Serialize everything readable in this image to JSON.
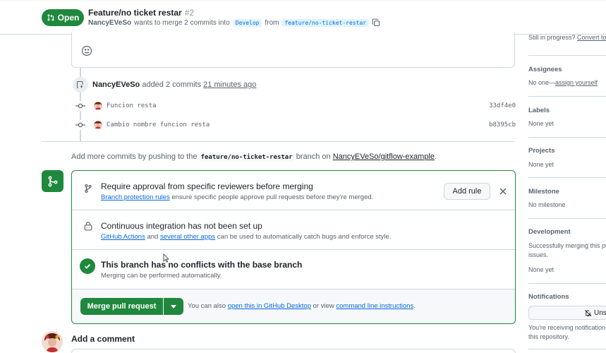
{
  "header": {
    "state": "Open",
    "title": "Feature/no ticket restar",
    "number": "#2",
    "author": "NancyEVeSo",
    "merge_text": "wants to merge 2 commits into",
    "base_branch": "Develop",
    "from_text": "from",
    "head_branch": "feature/no-ticket-restar"
  },
  "timeline": {
    "event_actor": "NancyEVeSo",
    "event_action": "added 2 commits",
    "event_time": "21 minutes ago",
    "commits": [
      {
        "message": "Funcion resta",
        "sha": "33df4e0"
      },
      {
        "message": "Cambio nombre funcion resta",
        "sha": "b8395cb"
      }
    ],
    "hint_prefix": "Add more commits by pushing to the",
    "hint_branch": "feature/no-ticket-restar",
    "hint_middle": "branch on",
    "hint_repo": "NancyEVeSo/gitflow-example",
    "hint_suffix": "."
  },
  "merge_box": {
    "review_title": "Require approval from specific reviewers before merging",
    "review_link": "Branch protection rules",
    "review_desc": "ensure specific people approve pull requests before they're merged.",
    "add_rule": "Add rule",
    "ci_title": "Continuous integration has not been set up",
    "ci_link1": "GitHub Actions",
    "ci_and": "and",
    "ci_link2": "several other apps",
    "ci_desc": "can be used to automatically catch bugs and enforce style.",
    "conflict_title": "This branch has no conflicts with the base branch",
    "conflict_desc": "Merging can be performed automatically.",
    "merge_button": "Merge pull request",
    "footer_prefix": "You can also",
    "footer_link1": "open this in GitHub Desktop",
    "footer_middle": "or view",
    "footer_link2": "command line instructions",
    "footer_suffix": "."
  },
  "comment": {
    "title": "Add a comment"
  },
  "sidebar": {
    "draft_text": "Still in progress?",
    "draft_link": "Convert to",
    "assignees_label": "Assignees",
    "assignees_value": "No one—",
    "assignees_link": "assign yourself",
    "labels_label": "Labels",
    "labels_value": "None yet",
    "projects_label": "Projects",
    "projects_value": "None yet",
    "milestone_label": "Milestone",
    "milestone_value": "No milestone",
    "development_label": "Development",
    "development_desc1": "Successfully merging this pu",
    "development_desc2": "issues.",
    "development_value": "None yet",
    "notifications_label": "Notifications",
    "unsubscribe": "Uns",
    "notif_desc1": "You're receiving notification",
    "notif_desc2": "this repository."
  },
  "colors": {
    "accent_green": "#1f883d",
    "link_blue": "#0969da",
    "border": "#d0d7de"
  }
}
